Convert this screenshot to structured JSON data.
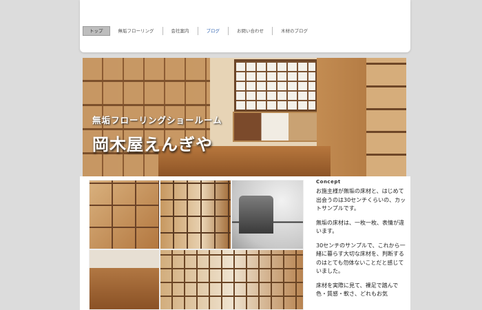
{
  "nav": {
    "items": [
      {
        "label": "トップ",
        "active": true
      },
      {
        "label": "無垢フローリング",
        "active": false
      },
      {
        "label": "会社案内",
        "active": false
      },
      {
        "label": "ブログ",
        "active": false
      },
      {
        "label": "お問い合わせ",
        "active": false
      },
      {
        "label": "木材のブログ",
        "active": false
      }
    ]
  },
  "hero": {
    "subtitle": "無垢フローリングショールーム",
    "title": "岡木屋えんぎや"
  },
  "content": {
    "concept_label": "Concept",
    "paragraphs": [
      "お施主様が無垢の床材と、はじめて出会うのは30センチくらいの、カットサンプルです。",
      "無垢の床材は、一枚一枚、表情が違います。",
      "30センチのサンプルで、これから一緒に暮らす大切な床材を、判断するのはとても勿体ないことだと感じていました。",
      "床材を実際に見て、裸足で踏んで色・質感・軟さ、どれもお気"
    ]
  },
  "colors": {
    "page_bg": "#dcdcdc",
    "active_tab_bg": "#bdbdbd",
    "blog_link": "#3a6bb5"
  }
}
